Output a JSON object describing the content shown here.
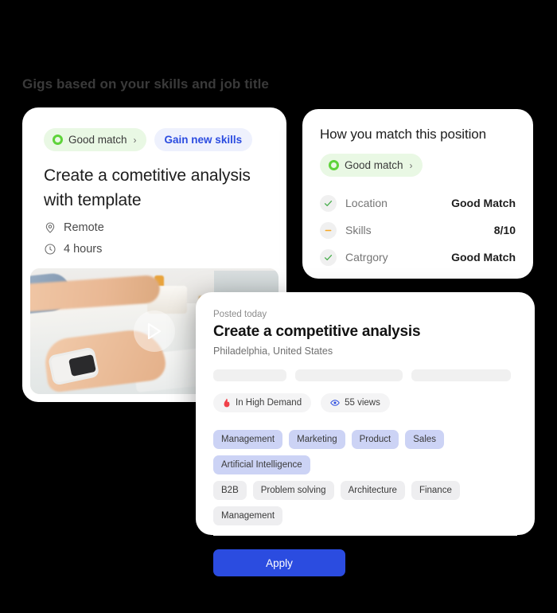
{
  "section": {
    "title": "Gigs based on your skills and job title"
  },
  "gig_card": {
    "good_match_label": "Good match",
    "good_match_chevron": "›",
    "gain_skills_label": "Gain new skills",
    "title": "Create a cometitive analysis with template",
    "location_icon": "location-pin-icon",
    "location": "Remote",
    "duration_icon": "clock-icon",
    "duration": "4 hours",
    "media_icon": "play-icon"
  },
  "match_card": {
    "title": "How you match this position",
    "good_match_label": "Good match",
    "good_match_chevron": "›",
    "rows": [
      {
        "icon": "check-icon",
        "label": "Location",
        "value": "Good Match"
      },
      {
        "icon": "dash-icon",
        "label": "Skills",
        "value": "8/10"
      },
      {
        "icon": "check-icon",
        "label": "Catrgory",
        "value": "Good Match"
      }
    ]
  },
  "detail_card": {
    "posted": "Posted today",
    "title": "Create a competitive analysis",
    "location": "Philadelphia, United States",
    "skeletons": 3,
    "badges": [
      {
        "icon": "flame-icon",
        "label": "In High Demand"
      },
      {
        "icon": "eye-icon",
        "label": "55 views"
      }
    ],
    "tags_primary": [
      "Management",
      "Marketing",
      "Product",
      "Sales",
      "Artificial Intelligence"
    ],
    "tags_muted": [
      "B2B",
      "Problem solving",
      "Architecture",
      "Finance",
      "Management"
    ],
    "apply_label": "Apply"
  },
  "colors": {
    "background": "#000000",
    "accent_blue": "#2b4ce0",
    "good_green": "#5ed33a",
    "good_green_bg": "#e9f8e4",
    "skills_bg": "#eef1fd",
    "warn_orange": "#f5a623",
    "flame_red": "#f0414a",
    "eye_blue": "#2b4ce0",
    "tag_primary_bg": "#ccd3f5",
    "tag_muted_bg": "#eeeef0"
  }
}
